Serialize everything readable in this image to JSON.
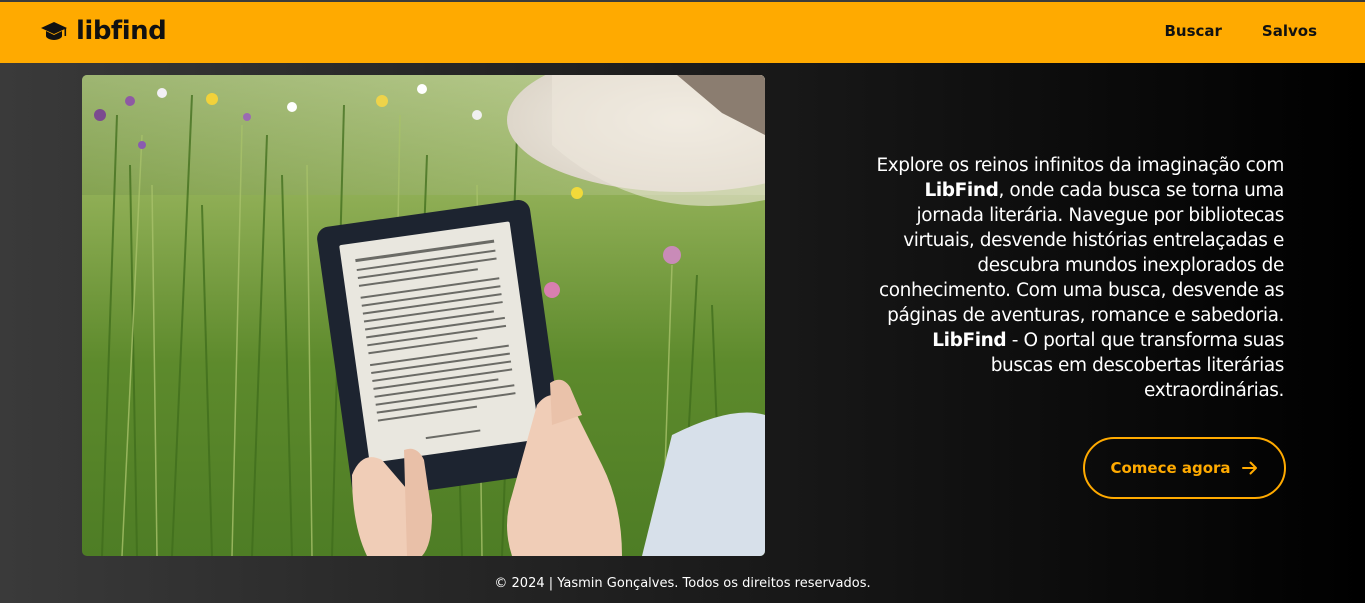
{
  "header": {
    "brand_name": "libfind",
    "brand_icon": "graduation-cap-icon",
    "nav": [
      {
        "label": "Buscar"
      },
      {
        "label": "Salvos"
      }
    ]
  },
  "hero": {
    "image": "person-reading-ereader-in-meadow",
    "description": {
      "part1": "Explore os reinos infinitos da imaginação com ",
      "brand1": "LibFind",
      "part2": ", onde cada busca se torna uma jornada literária. Navegue por bibliotecas virtuais, desvende histórias entrelaçadas e descubra mundos inexplorados de conhecimento. Com uma busca, desvende as páginas de aventuras, romance e sabedoria. ",
      "brand2": "LibFind",
      "part3": " - O portal que transforma suas buscas em descobertas literárias extraordinárias."
    },
    "cta_label": "Comece agora",
    "cta_icon": "arrow-right-icon"
  },
  "footer": {
    "text": "© 2024 | Yasmin Gonçalves. Todos os direitos reservados."
  },
  "colors": {
    "accent": "#ffaa00",
    "header_bg": "#ffaa00",
    "text_light": "#ffffff"
  }
}
